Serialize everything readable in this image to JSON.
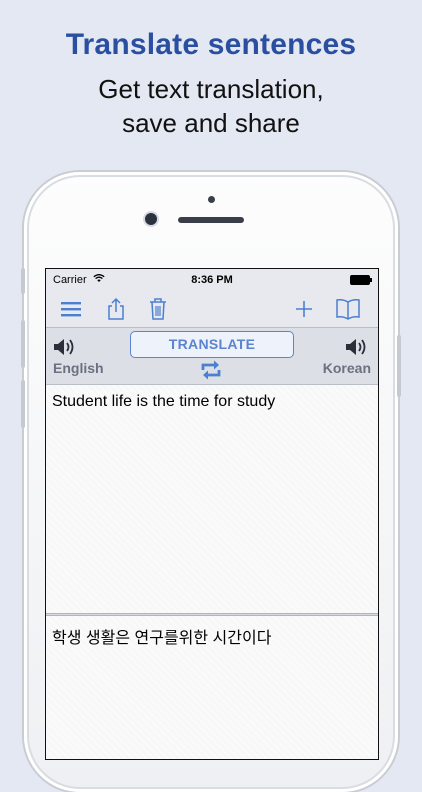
{
  "promo": {
    "headline": "Translate sentences",
    "sub_line1": "Get text translation,",
    "sub_line2": "save and share"
  },
  "status_bar": {
    "carrier": "Carrier",
    "time": "8:36 PM"
  },
  "toolbar": {
    "icons": [
      "menu-icon",
      "share-icon",
      "trash-icon",
      "add-icon",
      "book-icon"
    ]
  },
  "controls": {
    "translate_label": "TRANSLATE",
    "source_language": "English",
    "target_language": "Korean"
  },
  "source_text": "Student life is the time for study",
  "translated_text": "학생 생활은 연구를위한 시간이다",
  "colors": {
    "accent": "#5a84cf",
    "headline": "#2a4ea0",
    "background": "#e4e8f3"
  }
}
